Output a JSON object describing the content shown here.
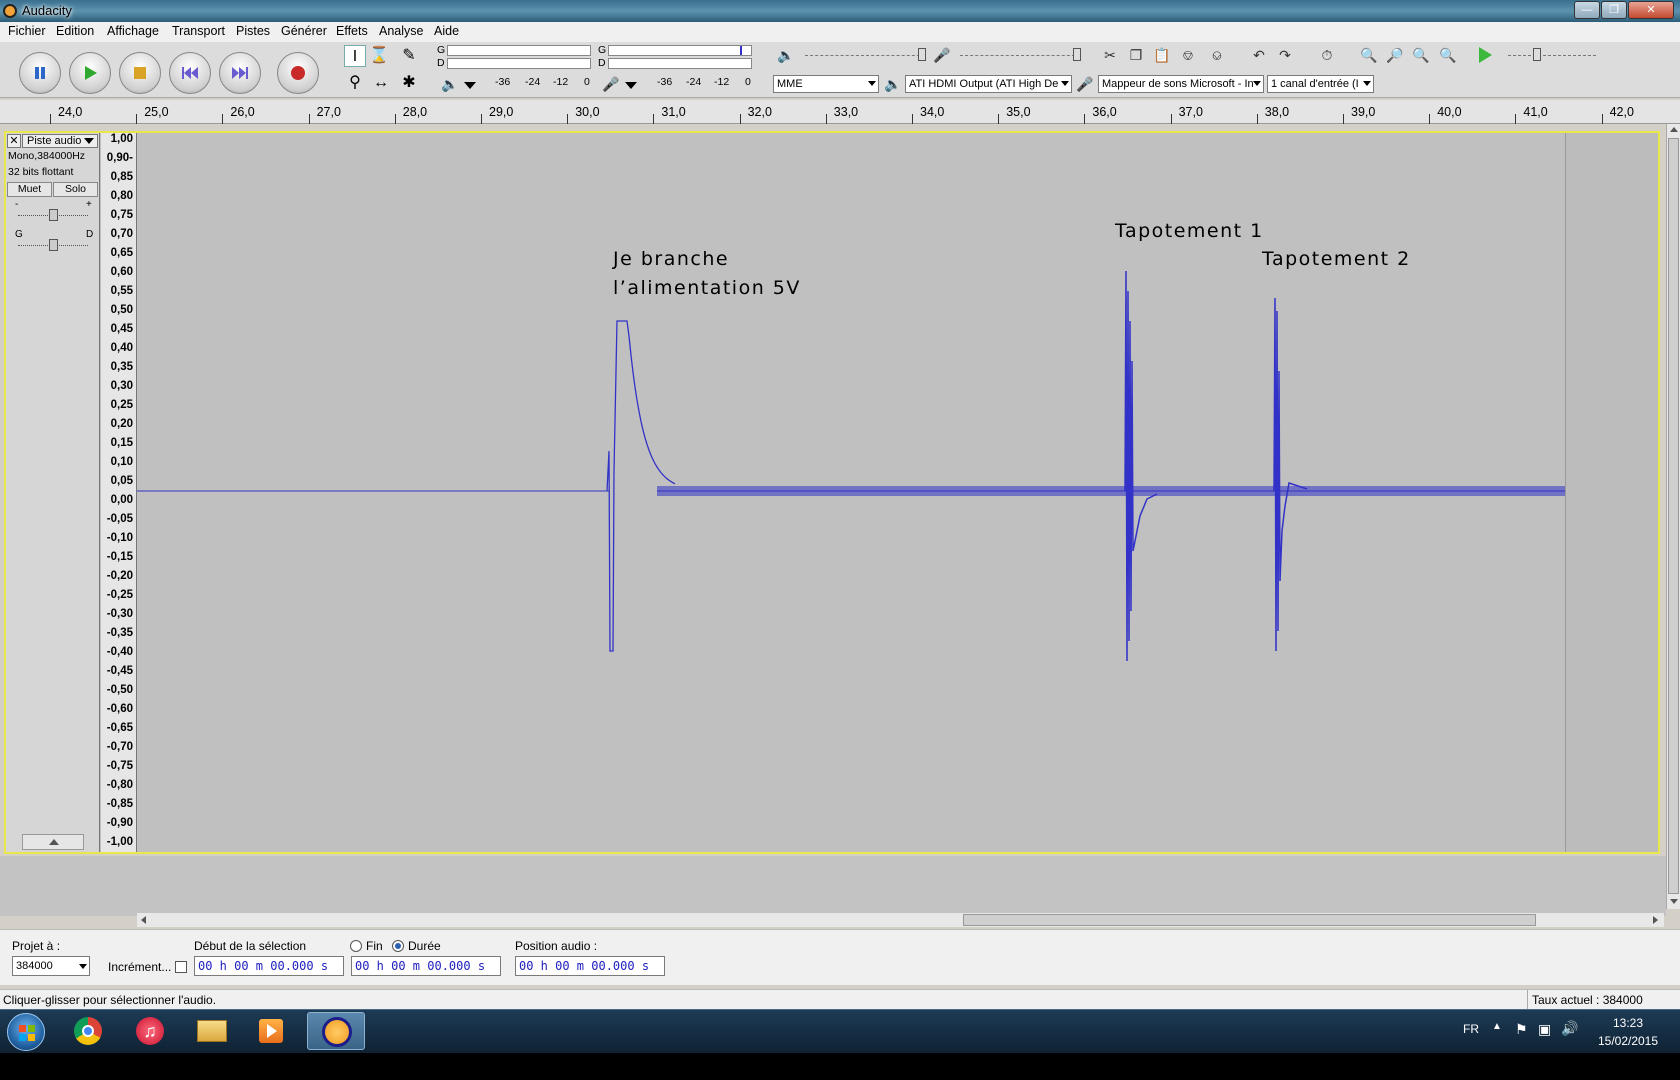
{
  "window": {
    "title": "Audacity"
  },
  "menu": [
    "Fichier",
    "Edition",
    "Affichage",
    "Transport",
    "Pistes",
    "Générer",
    "Effets",
    "Analyse",
    "Aide"
  ],
  "meters": {
    "play_left": "G",
    "play_right": "D",
    "rec_left": "G",
    "rec_right": "D",
    "db_labels_play": [
      "-36",
      "-24",
      "-12",
      "0"
    ],
    "db_labels_rec": [
      "-36",
      "-24",
      "-12",
      "0"
    ]
  },
  "devices": {
    "host": "MME",
    "output": "ATI HDMI Output (ATI High De",
    "input": "Mappeur de sons Microsoft - In",
    "channels": "1 canal d'entrée (I"
  },
  "ruler": {
    "labels": [
      "24,0",
      "25,0",
      "26,0",
      "27,0",
      "28,0",
      "29,0",
      "30,0",
      "31,0",
      "32,0",
      "33,0",
      "34,0",
      "35,0",
      "36,0",
      "37,0",
      "38,0",
      "39,0",
      "40,0",
      "41,0",
      "42,0"
    ]
  },
  "track": {
    "name": "Piste audio",
    "format": "Mono,384000Hz",
    "bits": "32 bits flottant",
    "mute_label": "Muet",
    "solo_label": "Solo",
    "gain_minus": "-",
    "gain_plus": "+",
    "pan_left": "G",
    "pan_right": "D"
  },
  "scale_labels": [
    "1,00",
    "0,90-",
    "0,85",
    "0,80",
    "0,75",
    "0,70",
    "0,65",
    "0,60",
    "0,55",
    "0,50",
    "0,45",
    "0,40",
    "0,35",
    "0,30",
    "0,25",
    "0,20",
    "0,15",
    "0,10",
    "0,05",
    "0,00",
    "-0,05",
    "-0,10",
    "-0,15",
    "-0,20",
    "-0,25",
    "-0,30",
    "-0,35",
    "-0,40",
    "-0,45",
    "-0,50",
    "-0,60",
    "-0,65",
    "-0,70",
    "-0,75",
    "-0,80",
    "-0,85",
    "-0,90",
    "-1,00"
  ],
  "annotations": {
    "branch_line1": "Je branche",
    "branch_line2": "l’alimentation 5V",
    "tap1": "Tapotement 1",
    "tap2": "Tapotement 2"
  },
  "selection": {
    "project_label": "Projet à :",
    "rate_value": "384000",
    "snap_label": "Incrément...",
    "start_label": "Début de la sélection",
    "end_label": "Fin",
    "duration_label": "Durée",
    "audio_pos_label": "Position audio :",
    "start_time": "00 h 00 m 00.000 s",
    "end_time": "00 h 00 m 00.000 s",
    "audio_pos": "00 h 00 m 00.000 s"
  },
  "status": {
    "hint": "Cliquer-glisser pour sélectionner l'audio.",
    "rate": "Taux actuel : 384000"
  },
  "taskbar": {
    "lang": "FR",
    "time": "13:23",
    "date": "15/02/2015"
  },
  "colors": {
    "wave": "#3232c8",
    "selection_border": "#e8e84a"
  }
}
